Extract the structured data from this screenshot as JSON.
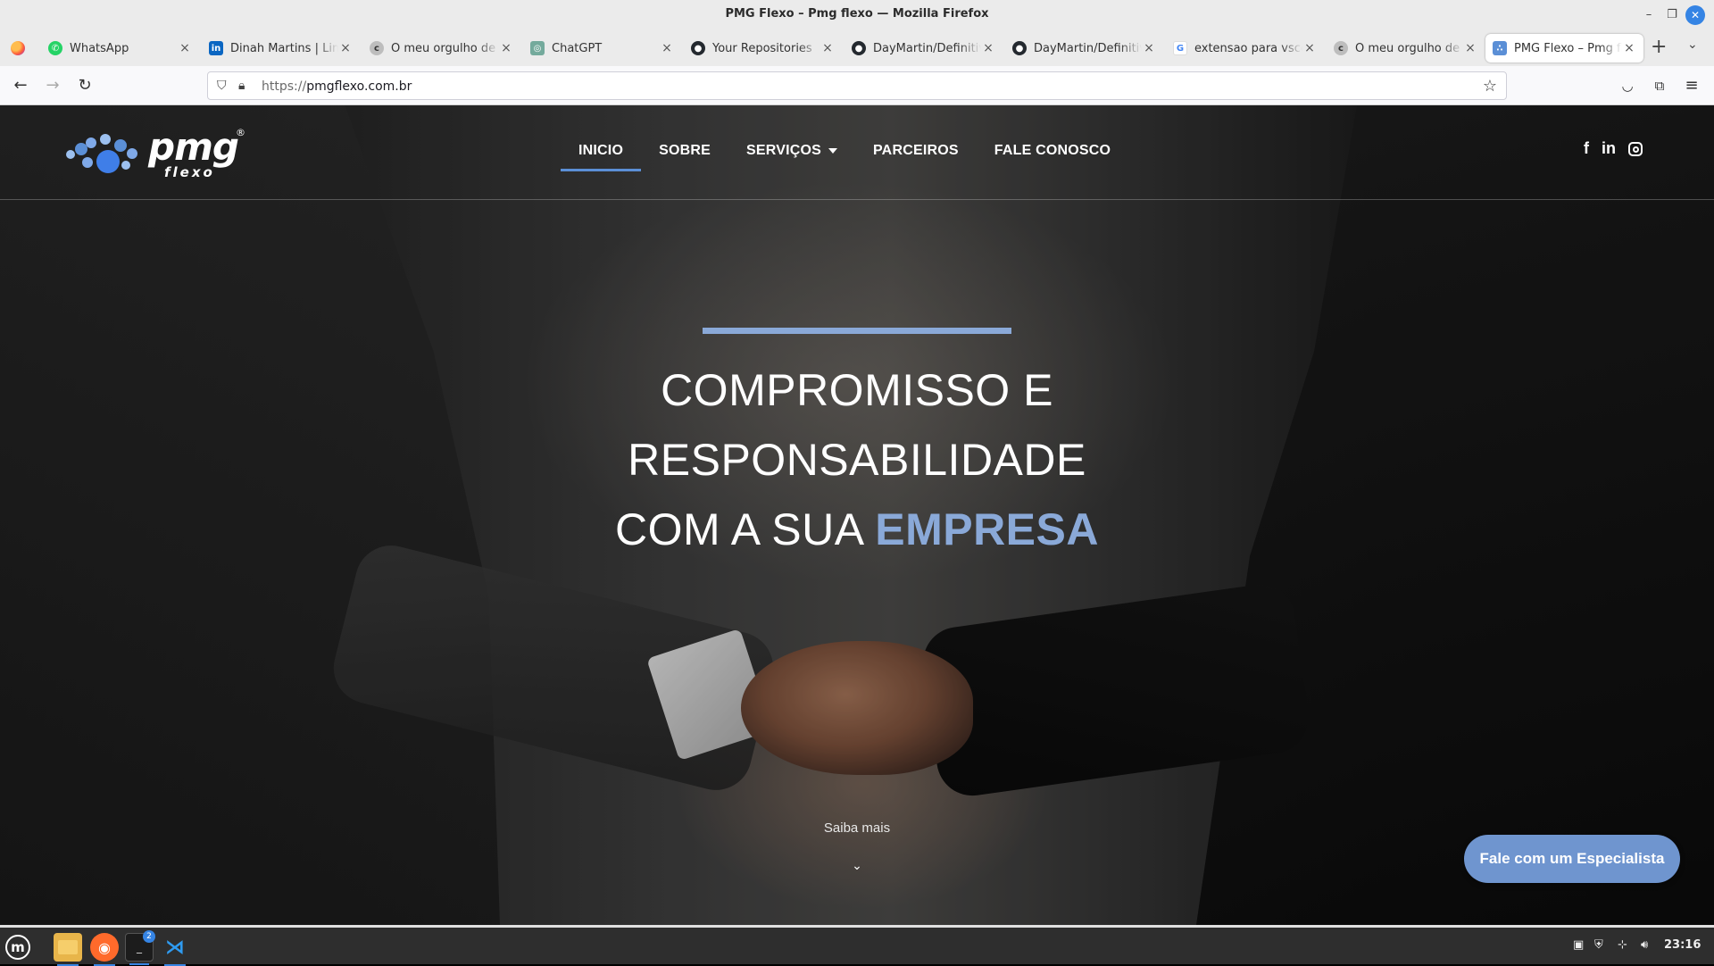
{
  "window": {
    "title": "PMG Flexo – Pmg flexo — Mozilla Firefox"
  },
  "tabs": [
    {
      "label": "WhatsApp",
      "icon": "whatsapp-icon",
      "color": "#25d366",
      "active": false
    },
    {
      "label": "Dinah Martins | LinkedIn",
      "icon": "linkedin-icon",
      "color": "#0a66c2",
      "active": false
    },
    {
      "label": "O meu orgulho de pertencer",
      "icon": "generic-site-icon",
      "color": "#9a9a9a",
      "active": false
    },
    {
      "label": "ChatGPT",
      "icon": "chatgpt-icon",
      "color": "#74aa9c",
      "active": false
    },
    {
      "label": "Your Repositories",
      "icon": "github-icon",
      "color": "#24292f",
      "active": false
    },
    {
      "label": "DayMartin/Definitivo",
      "icon": "github-icon",
      "color": "#24292f",
      "active": false
    },
    {
      "label": "DayMartin/Definitivo",
      "icon": "github-icon",
      "color": "#24292f",
      "active": false
    },
    {
      "label": "extensao para vscode",
      "icon": "google-icon",
      "color": "#4285f4",
      "active": false
    },
    {
      "label": "O meu orgulho de pertencer",
      "icon": "generic-site-icon",
      "color": "#9a9a9a",
      "active": false
    },
    {
      "label": "PMG Flexo – Pmg flexo",
      "icon": "pmg-favicon",
      "color": "#5b8fd6",
      "active": true
    }
  ],
  "address": {
    "protocol": "https://",
    "host": "pmgflexo.com.br"
  },
  "site": {
    "logo": {
      "word": "pmg",
      "sub": "flexo",
      "reg": "®"
    },
    "menu": {
      "inicio": "INICIO",
      "sobre": "SOBRE",
      "servicos": "SERVIÇOS",
      "parceiros": "PARCEIROS",
      "fale": "FALE CONOSCO"
    },
    "social": {
      "facebook": "f",
      "linkedin": "in"
    },
    "hero": {
      "line1": "COMPROMISSO E",
      "line2": "RESPONSABILIDADE",
      "line3_prefix": "COM A SUA ",
      "line3_accent": "EMPRESA"
    },
    "saiba_mais": "Saiba mais",
    "cta": "Fale com um Especialista",
    "accent_color": "#8aa9d8"
  },
  "taskbar": {
    "clock": "23:16",
    "terminal_badge": "2"
  }
}
